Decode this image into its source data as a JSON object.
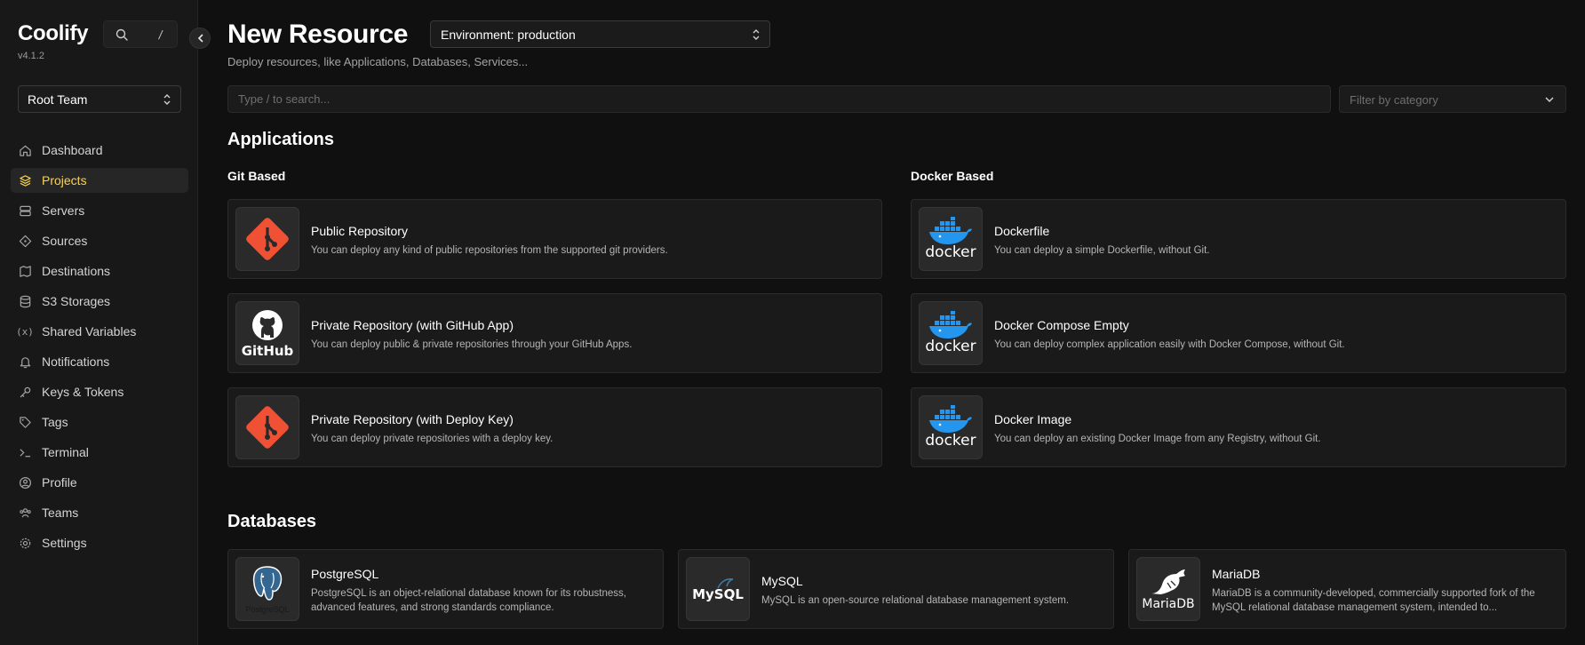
{
  "sidebar": {
    "brand": "Coolify",
    "version": "v4.1.2",
    "search_shortcut": "/",
    "team": "Root Team",
    "items": [
      {
        "label": "Dashboard",
        "icon": "home-icon",
        "active": false
      },
      {
        "label": "Projects",
        "icon": "layers-icon",
        "active": true
      },
      {
        "label": "Servers",
        "icon": "server-icon",
        "active": false
      },
      {
        "label": "Sources",
        "icon": "git-diamond-icon",
        "active": false
      },
      {
        "label": "Destinations",
        "icon": "map-icon",
        "active": false
      },
      {
        "label": "S3 Storages",
        "icon": "database-icon",
        "active": false
      },
      {
        "label": "Shared Variables",
        "icon": "variable-icon",
        "active": false
      },
      {
        "label": "Notifications",
        "icon": "bell-icon",
        "active": false
      },
      {
        "label": "Keys & Tokens",
        "icon": "key-icon",
        "active": false
      },
      {
        "label": "Tags",
        "icon": "tag-icon",
        "active": false
      },
      {
        "label": "Terminal",
        "icon": "terminal-icon",
        "active": false
      },
      {
        "label": "Profile",
        "icon": "user-circle-icon",
        "active": false
      },
      {
        "label": "Teams",
        "icon": "users-icon",
        "active": false
      },
      {
        "label": "Settings",
        "icon": "gear-icon",
        "active": false
      }
    ]
  },
  "header": {
    "title": "New Resource",
    "environment": "Environment: production",
    "subtitle": "Deploy resources, like Applications, Databases, Services..."
  },
  "search": {
    "placeholder": "Type / to search...",
    "filter_placeholder": "Filter by category"
  },
  "applications": {
    "title": "Applications",
    "git_based": {
      "title": "Git Based",
      "cards": [
        {
          "title": "Public Repository",
          "desc": "You can deploy any kind of public repositories from the supported git providers.",
          "logo": "git"
        },
        {
          "title": "Private Repository (with GitHub App)",
          "desc": "You can deploy public & private repositories through your GitHub Apps.",
          "logo": "github"
        },
        {
          "title": "Private Repository (with Deploy Key)",
          "desc": "You can deploy private repositories with a deploy key.",
          "logo": "git"
        }
      ]
    },
    "docker_based": {
      "title": "Docker Based",
      "cards": [
        {
          "title": "Dockerfile",
          "desc": "You can deploy a simple Dockerfile, without Git.",
          "logo": "docker"
        },
        {
          "title": "Docker Compose Empty",
          "desc": "You can deploy complex application easily with Docker Compose, without Git.",
          "logo": "docker"
        },
        {
          "title": "Docker Image",
          "desc": "You can deploy an existing Docker Image from any Registry, without Git.",
          "logo": "docker"
        }
      ]
    }
  },
  "databases": {
    "title": "Databases",
    "cards": [
      {
        "title": "PostgreSQL",
        "desc": "PostgreSQL is an object-relational database known for its robustness, advanced features, and strong standards compliance.",
        "logo": "postgresql",
        "logo_text": "PostgreSQL"
      },
      {
        "title": "MySQL",
        "desc": "MySQL is an open-source relational database management system.",
        "logo": "mysql",
        "logo_text": "MySQL"
      },
      {
        "title": "MariaDB",
        "desc": "MariaDB is a community-developed, commercially supported fork of the MySQL relational database management system, intended to...",
        "logo": "mariadb",
        "logo_text": "MariaDB"
      }
    ]
  },
  "logo_text": {
    "github": "GitHub",
    "docker": "docker"
  },
  "colors": {
    "accent": "#fcd34d",
    "git": "#f05033",
    "docker": "#2496ed"
  }
}
